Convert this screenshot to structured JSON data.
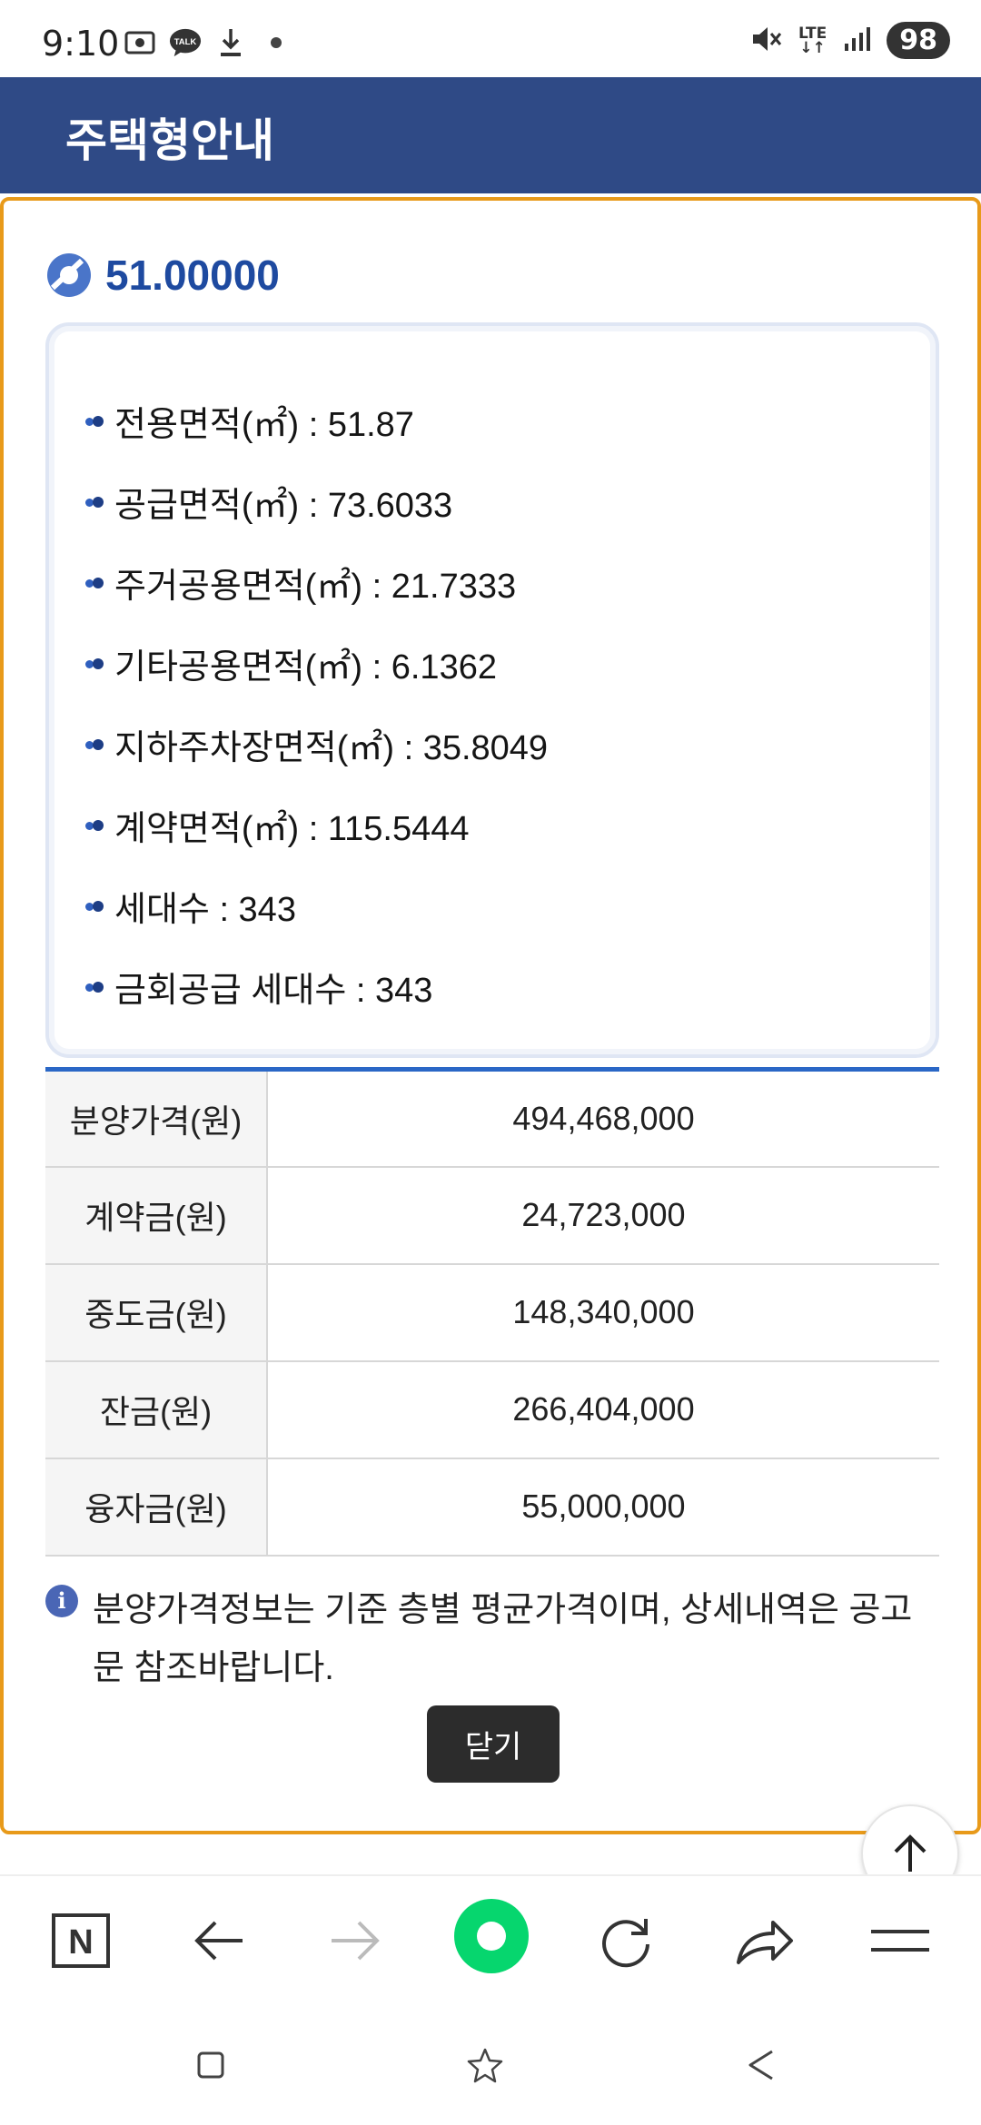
{
  "status_bar": {
    "time": "9:10",
    "talk_badge": "TALK",
    "network": "LTE",
    "battery": "98"
  },
  "header": {
    "title": "주택형안내"
  },
  "housing_type": {
    "title": "51.00000"
  },
  "details": [
    {
      "label": "전용면적(㎡) : 51.87"
    },
    {
      "label": "공급면적(㎡) : 73.6033"
    },
    {
      "label": "주거공용면적(㎡) : 21.7333"
    },
    {
      "label": "기타공용면적(㎡) : 6.1362"
    },
    {
      "label": "지하주차장면적(㎡) : 35.8049"
    },
    {
      "label": "계약면적(㎡) : 115.5444"
    },
    {
      "label": "세대수 : 343"
    },
    {
      "label": "금회공급 세대수 : 343"
    }
  ],
  "price_table": [
    {
      "label": "분양가격(원)",
      "value": "494,468,000"
    },
    {
      "label": "계약금(원)",
      "value": "24,723,000"
    },
    {
      "label": "중도금(원)",
      "value": "148,340,000"
    },
    {
      "label": "잔금(원)",
      "value": "266,404,000"
    },
    {
      "label": "융자금(원)",
      "value": "55,000,000"
    }
  ],
  "notice": {
    "icon_text": "i",
    "text": "분양가격정보는 기준 층별 평균가격이며, 상세내역은 공고문 참조바랍니다."
  },
  "close_label": "닫기",
  "toolbar": {
    "naver_logo": "N"
  },
  "colors": {
    "header": "#2f4a86",
    "modal_border": "#e89a1a",
    "accent": "#1e4aa0",
    "home": "#06d66e"
  }
}
